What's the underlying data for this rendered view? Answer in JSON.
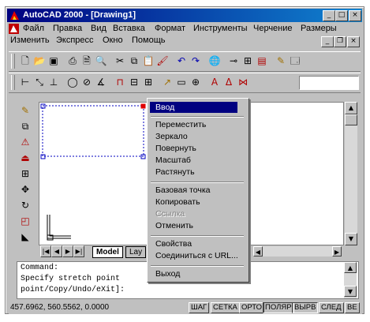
{
  "window": {
    "title": "AutoCAD 2000 - [Drawing1]",
    "caption_buttons": {
      "minimize": "_",
      "restore": "□",
      "close": "×"
    },
    "doc_buttons": {
      "minimize": "_",
      "restore": "❐",
      "close": "×"
    }
  },
  "menubar": {
    "row1": [
      {
        "label": "Файл"
      },
      {
        "label": "Правка"
      },
      {
        "label": "Вид"
      },
      {
        "label": "Вставка"
      },
      {
        "label": "Формат"
      },
      {
        "label": "Инструменты"
      },
      {
        "label": "Черчение"
      },
      {
        "label": "Размеры"
      }
    ],
    "row2": [
      {
        "label": "Изменить"
      },
      {
        "label": "Экспресс"
      },
      {
        "label": "Окно"
      },
      {
        "label": "Помощь"
      }
    ]
  },
  "toolbar1_icons": [
    "new-icon",
    "open-icon",
    "save-icon",
    "print-icon",
    "preview-icon",
    "find-icon",
    "cut-icon",
    "copy-icon",
    "paste-icon",
    "match-icon",
    "undo-icon",
    "redo-icon",
    "link-icon",
    "snap-icon",
    "ortho-icon",
    "layer-icon",
    "pen-icon",
    "window-icon"
  ],
  "toolbar2_icons": [
    "dim-linear-icon",
    "dim-aligned-icon",
    "dim-ordinate-icon",
    "dim-radius-icon",
    "dim-diameter-icon",
    "dim-angular-icon",
    "quick-dim-icon",
    "baseline-icon",
    "continue-icon",
    "leader-icon",
    "tolerance-icon",
    "center-icon",
    "dim-edit-icon",
    "dim-text-icon",
    "dim-style-icon"
  ],
  "left_toolbar_icons": [
    "erase-icon",
    "copy-object-icon",
    "mirror-icon",
    "offset-icon",
    "array-icon",
    "move-icon",
    "rotate-icon",
    "scale-icon",
    "stretch-icon"
  ],
  "tabs": {
    "model": "Model",
    "layout": "Lay"
  },
  "command": {
    "line1": "Command:",
    "line2": "Specify stretch point",
    "line3": "point/Copy/Undo/eXit]:"
  },
  "status": {
    "coords": "457.6962, 560.5562, 0.0000",
    "buttons": [
      "ШАГ",
      "СЕТКА",
      "ОРТО",
      "ПОЛЯР",
      "ВЫРВ",
      "СЛЕД",
      "ВЕ"
    ]
  },
  "context_menu": {
    "enter": "Ввод",
    "group1": [
      "Переместить",
      "Зеркало",
      "Повернуть",
      "Масштаб",
      "Растянуть"
    ],
    "group2": [
      "Базовая точка",
      "Копировать",
      "Ссылка",
      "Отменить"
    ],
    "group3": [
      "Свойства",
      "Соединиться с URL..."
    ],
    "exit": "Выход"
  }
}
